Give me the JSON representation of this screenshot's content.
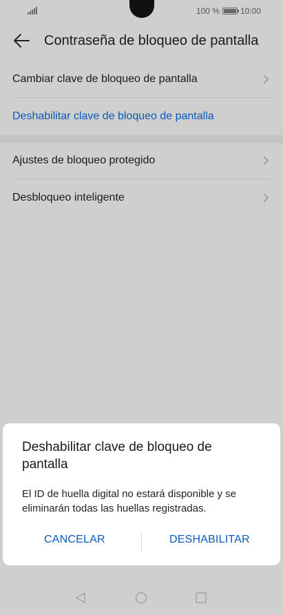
{
  "status_bar": {
    "battery_text": "100 %",
    "time": "10:00"
  },
  "header": {
    "title": "Contraseña de bloqueo de pantalla"
  },
  "settings": {
    "group1": [
      {
        "label": "Cambiar clave de bloqueo de pantalla",
        "icon": "chevron-right-icon"
      },
      {
        "label": "Deshabilitar clave de bloqueo de pantalla"
      }
    ],
    "group2": [
      {
        "label": "Ajustes de bloqueo protegido",
        "icon": "chevron-right-icon"
      },
      {
        "label": "Desbloqueo inteligente",
        "icon": "chevron-right-icon"
      }
    ]
  },
  "dialog": {
    "title": "Deshabilitar clave de bloqueo de pantalla",
    "message": "El ID de huella digital no estará disponible y se eliminarán todas las huellas registradas.",
    "cancel_label": "CANCELAR",
    "confirm_label": "DESHABILITAR"
  },
  "colors": {
    "accent": "#0a59b8",
    "overlay_bg": "#cfcfcf",
    "dialog_bg": "#ffffff"
  }
}
